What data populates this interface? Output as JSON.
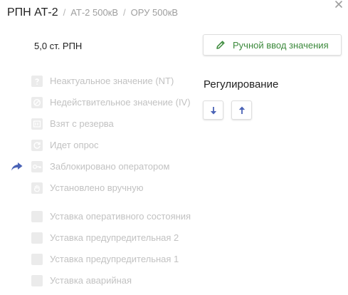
{
  "header": {
    "title": "РПН АТ-2",
    "separator": "/",
    "breadcrumbs": [
      "АТ-2 500кВ",
      "ОРУ 500кВ"
    ]
  },
  "icons": {
    "close": "close-icon",
    "pencil": "pencil-icon",
    "arrow_down": "arrow-down-icon",
    "arrow_up": "arrow-up-icon",
    "blocked_indicator": "share-arrow-icon"
  },
  "value": "5,0 ст. РПН",
  "manual_input": {
    "label": "Ручной ввод значения",
    "color": "#3c8a3c"
  },
  "regulation": {
    "title": "Регулирование"
  },
  "colors": {
    "accent": "#4a63b6",
    "muted_text": "#c2c2c2",
    "icon_bg": "#ebebeb"
  },
  "flags": [
    {
      "label": "Неактуальное значение (NT)",
      "icon": "question-icon",
      "active": false
    },
    {
      "label": "Недействительное значение (IV)",
      "icon": "forbidden-icon",
      "active": false
    },
    {
      "label": "Взят с резерва",
      "icon": "reserve-icon",
      "active": false
    },
    {
      "label": "Идет опрос",
      "icon": "refresh-icon",
      "active": false
    },
    {
      "label": "Заблокировано оператором",
      "icon": "key-icon",
      "active": true
    },
    {
      "label": "Установлено вручную",
      "icon": "hand-icon",
      "active": false
    },
    {
      "label": "Уставка оперативного состояния",
      "icon": "blank-icon",
      "active": false
    },
    {
      "label": "Уставка предупредительная 2",
      "icon": "blank-icon",
      "active": false
    },
    {
      "label": "Уставка предупредительная 1",
      "icon": "blank-icon",
      "active": false
    },
    {
      "label": "Уставка аварийная",
      "icon": "blank-icon",
      "active": false
    }
  ]
}
